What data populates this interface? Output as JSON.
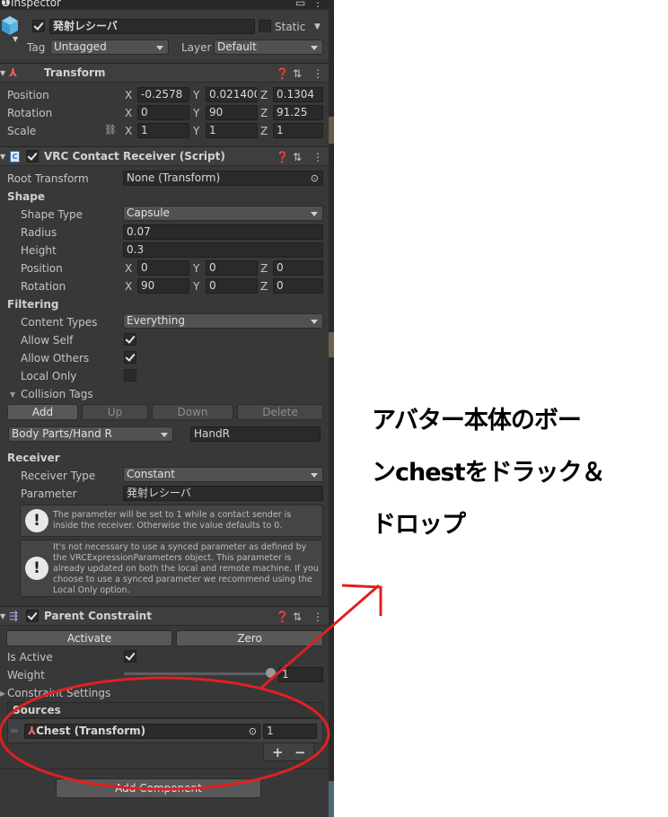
{
  "tab": {
    "title": "Inspector"
  },
  "object": {
    "name": "発射レシーバ",
    "static_label": "Static",
    "tag_label": "Tag",
    "tag_value": "Untagged",
    "layer_label": "Layer",
    "layer_value": "Default"
  },
  "transform": {
    "title": "Transform",
    "position": {
      "label": "Position",
      "x": "-0.2578",
      "y": "0.021400",
      "z": "0.1304"
    },
    "rotation": {
      "label": "Rotation",
      "x": "0",
      "y": "90",
      "z": "91.25"
    },
    "scale": {
      "label": "Scale",
      "x": "1",
      "y": "1",
      "z": "1"
    }
  },
  "receiver_script": {
    "title": "VRC Contact Receiver (Script)",
    "root_transform": {
      "label": "Root Transform",
      "value": "None (Transform)"
    },
    "shape": {
      "heading": "Shape",
      "shape_type": {
        "label": "Shape Type",
        "value": "Capsule"
      },
      "radius": {
        "label": "Radius",
        "value": "0.07"
      },
      "height": {
        "label": "Height",
        "value": "0.3"
      },
      "position": {
        "label": "Position",
        "x": "0",
        "y": "0",
        "z": "0"
      },
      "rotation": {
        "label": "Rotation",
        "x": "90",
        "y": "0",
        "z": "0"
      }
    },
    "filtering": {
      "heading": "Filtering",
      "content_types": {
        "label": "Content Types",
        "value": "Everything"
      },
      "allow_self": {
        "label": "Allow Self",
        "checked": true
      },
      "allow_others": {
        "label": "Allow Others",
        "checked": true
      },
      "local_only": {
        "label": "Local Only",
        "checked": false
      },
      "collision_tags": {
        "label": "Collision Tags",
        "add": "Add",
        "up": "Up",
        "down": "Down",
        "delete": "Delete"
      },
      "tag_preset": "Body Parts/Hand R",
      "tag_value": "HandR"
    },
    "receiver": {
      "heading": "Receiver",
      "receiver_type": {
        "label": "Receiver Type",
        "value": "Constant"
      },
      "parameter": {
        "label": "Parameter",
        "value": "発射レシーバ"
      },
      "help1": "The parameter will be set to 1 while a contact sender is inside the receiver.  Otherwise the value defaults to 0.",
      "help2": "It's not necessary to use a synced parameter as defined by the VRCExpressionParameters object.  This parameter is already updated on both the local and remote machine.  If you choose to use a synced parameter we recommend using the Local Only option."
    }
  },
  "parent_constraint": {
    "title": "Parent Constraint",
    "activate": "Activate",
    "zero": "Zero",
    "is_active": {
      "label": "Is Active",
      "checked": true
    },
    "weight": {
      "label": "Weight",
      "value": "1",
      "fraction": 1.0
    },
    "constraint_settings": "Constraint Settings",
    "sources": {
      "heading": "Sources",
      "items": [
        {
          "name": "Chest (Transform)",
          "weight": "1"
        }
      ],
      "plus": "+",
      "minus": "−"
    }
  },
  "add_component": "Add Component",
  "annotation": {
    "lines": [
      "アバター本体のボー",
      "ンchestをドラック＆",
      "ドロップ"
    ],
    "color": "#e02020"
  },
  "icons": [
    "info-icon",
    "help-icon",
    "presets-icon",
    "kebab-menu-icon",
    "cube-icon",
    "transform-icon",
    "script-icon",
    "constraint-icon",
    "link-icon",
    "object-picker-icon"
  ]
}
